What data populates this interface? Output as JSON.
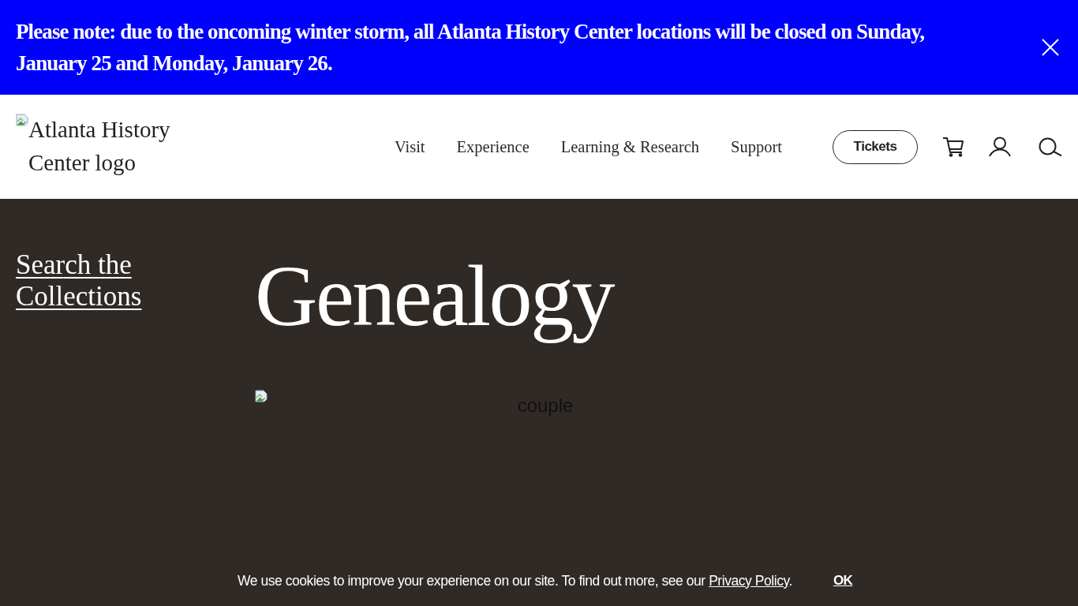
{
  "alert": {
    "message": "Please note: due to the oncoming winter storm, all Atlanta History Center locations will be closed on Sunday, January 25 and Monday, January 26."
  },
  "header": {
    "logo_alt": "Atlanta History Center logo",
    "nav": [
      {
        "label": "Visit"
      },
      {
        "label": "Experience"
      },
      {
        "label": "Learning & Research"
      },
      {
        "label": "Support"
      }
    ],
    "tickets_button": "Tickets"
  },
  "sidebar": {
    "link": "Search the Collections"
  },
  "page": {
    "title": "Genealogy",
    "image_alt": "couple"
  },
  "cookie_notice": {
    "text": "We use cookies to improve your experience on our site. To find out more, see our ",
    "link": "Privacy Policy",
    "suffix": ".",
    "button": "OK"
  }
}
